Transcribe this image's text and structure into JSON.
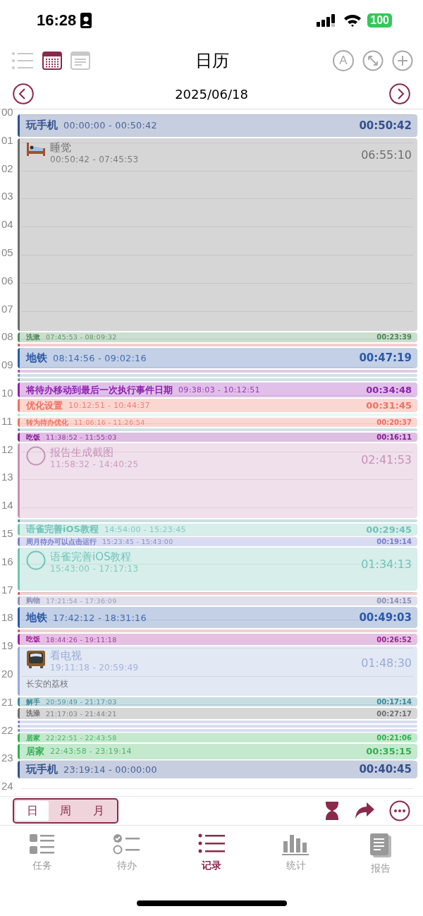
{
  "status_bar": {
    "time": "16:28",
    "battery": "100"
  },
  "toolbar": {
    "title": "日历",
    "views": [
      {
        "kind": "list",
        "selected": false
      },
      {
        "kind": "calendar",
        "selected": true
      },
      {
        "kind": "document",
        "selected": false
      }
    ],
    "actions": [
      {
        "kind": "font",
        "label": "A",
        "disabled": true
      },
      {
        "kind": "expand",
        "disabled": true
      },
      {
        "kind": "add",
        "disabled": true
      }
    ]
  },
  "date_nav": {
    "date": "2025/06/18"
  },
  "hours": [
    "00",
    "01",
    "02",
    "03",
    "04",
    "05",
    "06",
    "07",
    "08",
    "09",
    "10",
    "11",
    "12",
    "13",
    "14",
    "15",
    "16",
    "17",
    "18",
    "19",
    "20",
    "21",
    "22",
    "23",
    "24"
  ],
  "events": [
    {
      "kind": "row",
      "title": "玩手机",
      "time": "00:00:00 - 00:50:42",
      "duration": "00:50:42",
      "color": "#34508e"
    },
    {
      "kind": "bed",
      "title": "睡觉",
      "time": "00:50:42 - 07:45:53",
      "duration": "06:55:10",
      "color": "#6e6e6e"
    },
    {
      "kind": "row",
      "title": "洗漱",
      "time": "07:45:53 - 08:09:32",
      "duration": "00:23:39",
      "color": "#4a8a55"
    },
    {
      "kind": "strip",
      "color": "#d05060"
    },
    {
      "kind": "row",
      "title": "地铁",
      "time": "08:14:56 - 09:02:16",
      "duration": "00:47:19",
      "color": "#2a5aa8"
    },
    {
      "kind": "strip",
      "color": "#9a40b0"
    },
    {
      "kind": "strip",
      "color": "#5a9aa8"
    },
    {
      "kind": "strip",
      "color": "#5a9aa8"
    },
    {
      "kind": "row",
      "title": "将待办移动到最后一次执行事件日期",
      "time": "09:38:03 - 10:12:51",
      "duration": "00:34:48",
      "color": "#9020b0"
    },
    {
      "kind": "row",
      "title": "优化设置",
      "time": "10:12:51 - 10:44:37",
      "duration": "00:31:45",
      "color": "#f07060"
    },
    {
      "kind": "strip",
      "color": "#a8e8dc"
    },
    {
      "kind": "row",
      "title": "转为待办优化",
      "time": "11:06:16 - 11:26:54",
      "duration": "00:20:37",
      "color": "#f07060"
    },
    {
      "kind": "strip",
      "color": "#5a9aa8"
    },
    {
      "kind": "row",
      "title": "吃饭",
      "time": "11:38:52 - 11:55:03",
      "duration": "00:16:11",
      "color": "#8a1a9a"
    },
    {
      "kind": "todo",
      "title": "报告生成截图",
      "time": "11:58:32 - 14:40:25",
      "duration": "02:41:53",
      "color": "#c890b8"
    },
    {
      "kind": "strip",
      "color": "#4a8a98"
    },
    {
      "kind": "row",
      "title": "语雀完善iOS教程",
      "time": "14:54:00 - 15:23:45",
      "duration": "00:29:45",
      "color": "#70c4b8"
    },
    {
      "kind": "row",
      "title": "周月待办可以点击运行",
      "time": "15:23:45 - 15:43:00",
      "duration": "00:19:14",
      "color": "#7a80cc"
    },
    {
      "kind": "todo",
      "title": "语雀完善iOS教程",
      "time": "15:43:00 - 17:17:13",
      "duration": "01:34:13",
      "color": "#70c4b8"
    },
    {
      "kind": "strip",
      "color": "#d05060"
    },
    {
      "kind": "row",
      "title": "购物",
      "time": "17:21:54 - 17:36:09",
      "duration": "00:14:15",
      "color": "#8c90b8"
    },
    {
      "kind": "row",
      "title": "地铁",
      "time": "17:42:12 - 18:31:16",
      "duration": "00:49:03",
      "color": "#2a5aa8"
    },
    {
      "kind": "strip",
      "color": "#d05060"
    },
    {
      "kind": "row",
      "title": "吃饭",
      "time": "18:44:26 - 19:11:18",
      "duration": "00:26:52",
      "color": "#a0209a"
    },
    {
      "kind": "tv",
      "title": "看电视",
      "time": "19:11:18 - 20:59:49",
      "duration": "01:48:30",
      "note": "长安的荔枝",
      "color": "#98acd8"
    },
    {
      "kind": "row",
      "title": "解手",
      "time": "20:59:49 - 21:17:03",
      "duration": "00:17:14",
      "color": "#3a8a98"
    },
    {
      "kind": "row",
      "title": "洗澡",
      "time": "21:17:03 - 21:44:21",
      "duration": "00:27:17",
      "color": "#707070"
    },
    {
      "kind": "strip",
      "color": "#7a88cc"
    },
    {
      "kind": "strip",
      "color": "#7a88cc"
    },
    {
      "kind": "strip",
      "color": "#7a88cc"
    },
    {
      "kind": "row",
      "title": "居家",
      "time": "22:22:51 - 22:43:58",
      "duration": "00:21:06",
      "color": "#30b050"
    },
    {
      "kind": "row",
      "title": "居家",
      "time": "22:43:58 - 23:19:14",
      "duration": "00:35:15",
      "color": "#30b050"
    },
    {
      "kind": "row",
      "title": "玩手机",
      "time": "23:19:14 - 00:00:00",
      "duration": "00:40:45",
      "color": "#34508e"
    }
  ],
  "range_tabs": [
    {
      "label": "日",
      "selected": true
    },
    {
      "label": "周",
      "selected": false
    },
    {
      "label": "月",
      "selected": false
    }
  ],
  "tab_bar": [
    {
      "kind": "tasks",
      "label": "任务",
      "selected": false
    },
    {
      "kind": "todo",
      "label": "待办",
      "selected": false
    },
    {
      "kind": "records",
      "label": "记录",
      "selected": true
    },
    {
      "kind": "stats",
      "label": "统计",
      "selected": false
    },
    {
      "kind": "report",
      "label": "报告",
      "selected": false
    }
  ]
}
